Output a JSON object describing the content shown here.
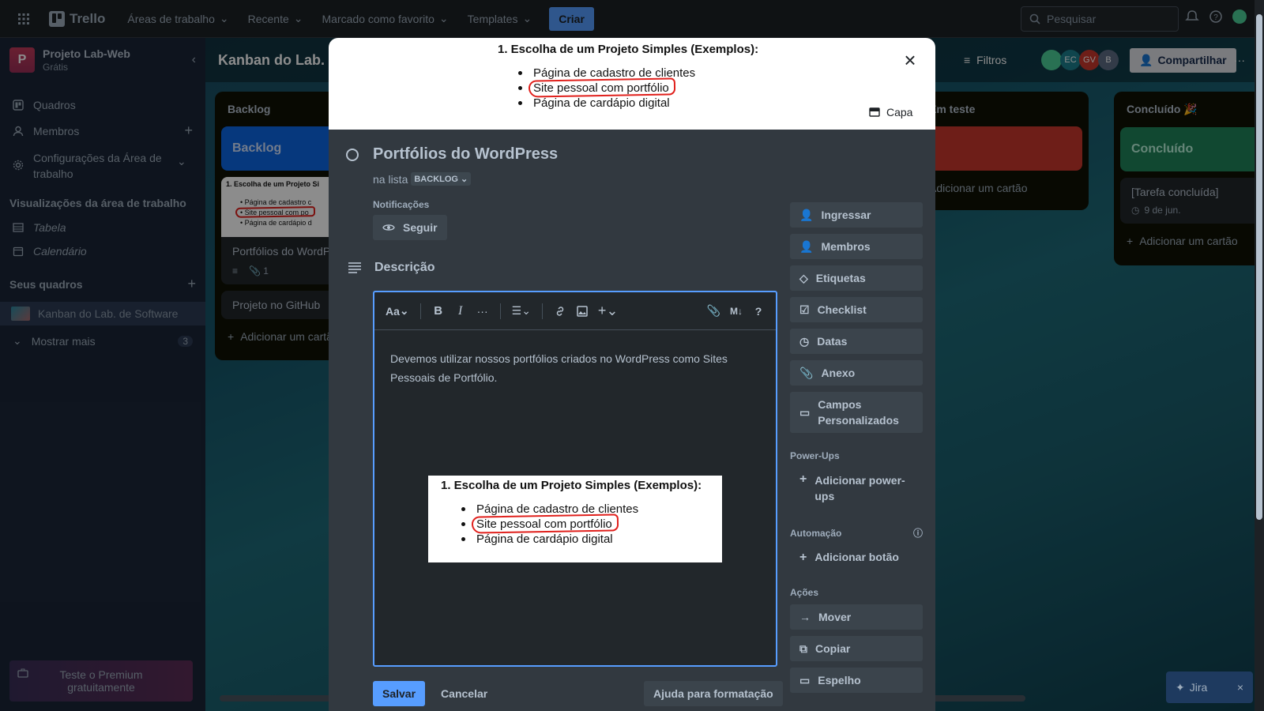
{
  "topbar": {
    "app_name": "Trello",
    "menus": [
      "Áreas de trabalho",
      "Recente",
      "Marcado como favorito",
      "Templates"
    ],
    "create_label": "Criar",
    "search_placeholder": "Pesquisar"
  },
  "sidebar": {
    "workspace_initial": "P",
    "workspace_name": "Projeto Lab-Web",
    "workspace_plan": "Grátis",
    "items": [
      {
        "label": "Quadros",
        "icon": "board-icon"
      },
      {
        "label": "Membros",
        "icon": "person-icon"
      },
      {
        "label": "Configurações da Área de trabalho",
        "icon": "gear-icon"
      }
    ],
    "views_title": "Visualizações da área de trabalho",
    "views": [
      {
        "label": "Tabela",
        "icon": "table-icon"
      },
      {
        "label": "Calendário",
        "icon": "calendar-icon"
      }
    ],
    "boards_title": "Seus quadros",
    "current_board": "Kanban do Lab. de Software",
    "show_more_label": "Mostrar mais",
    "show_more_count": "3",
    "premium_label": "Teste o Premium gratuitamente"
  },
  "board": {
    "title": "Kanban do Lab. de Software",
    "filters_label": "Filtros",
    "share_label": "Compartilhar",
    "members": [
      {
        "initials": "",
        "color": "#4bce97"
      },
      {
        "initials": "EC",
        "color": "#1d7f8c"
      },
      {
        "initials": "GV",
        "color": "#c9372c"
      },
      {
        "initials": "B",
        "color": "#5e6c84"
      }
    ],
    "lists": [
      {
        "title": "Backlog",
        "header_card": "Backlog",
        "card_title": "Portfólios do WordPress",
        "card_attachments": "1",
        "card2": "Projeto no GitHub",
        "add_card": "Adicionar um cartão"
      },
      {
        "title": "Em teste",
        "add_card": "Adicionar um cartão"
      },
      {
        "title": "Concluído",
        "emoji": "🎉",
        "header_card": "Concluído",
        "card_title": "[Tarefa concluída]",
        "card_date": "9 de jun.",
        "add_card": "Adicionar um cartão"
      }
    ],
    "jira_label": "Jira",
    "colors": {
      "backlog": "#0c66e4",
      "teste": "#c9372c",
      "concluido": "#1f845a"
    }
  },
  "modal": {
    "cover": {
      "heading": "1. Escolha de um Projeto Simples (Exemplos):",
      "items": [
        "Página de cadastro de clientes",
        "Site pessoal com portfólio",
        "Página de cardápio digital"
      ],
      "capa_label": "Capa"
    },
    "title": "Portfólios do WordPress",
    "in_list_prefix": "na lista",
    "list_name": "BACKLOG",
    "notifications_label": "Notificações",
    "follow_label": "Seguir",
    "description_label": "Descrição",
    "editor": {
      "font_label": "Aa",
      "markdown_label": "M↓",
      "text": "Devemos utilizar nossos portfólios criados no WordPress como Sites Pessoais de Portfólio.",
      "image": {
        "heading": "1. Escolha de um Projeto Simples (Exemplos):",
        "items": [
          "Página de cadastro de clientes",
          "Site pessoal com portfólio",
          "Página de cardápio digital"
        ]
      }
    },
    "save_label": "Salvar",
    "cancel_label": "Cancelar",
    "help_label": "Ajuda para formatação",
    "side": {
      "add_to_card": [
        {
          "label": "Ingressar",
          "icon": "join-icon"
        },
        {
          "label": "Membros",
          "icon": "person-icon"
        },
        {
          "label": "Etiquetas",
          "icon": "tag-icon"
        },
        {
          "label": "Checklist",
          "icon": "checklist-icon"
        },
        {
          "label": "Datas",
          "icon": "clock-icon"
        },
        {
          "label": "Anexo",
          "icon": "paperclip-icon"
        },
        {
          "label": "Campos Personalizados",
          "icon": "fields-icon"
        }
      ],
      "powerups_label": "Power-Ups",
      "add_powerups": "Adicionar power-ups",
      "automation_label": "Automação",
      "add_button": "Adicionar botão",
      "actions_label": "Ações",
      "actions": [
        {
          "label": "Mover",
          "icon": "arrow-right-icon"
        },
        {
          "label": "Copiar",
          "icon": "copy-icon"
        },
        {
          "label": "Espelho",
          "icon": "mirror-icon"
        }
      ]
    }
  }
}
